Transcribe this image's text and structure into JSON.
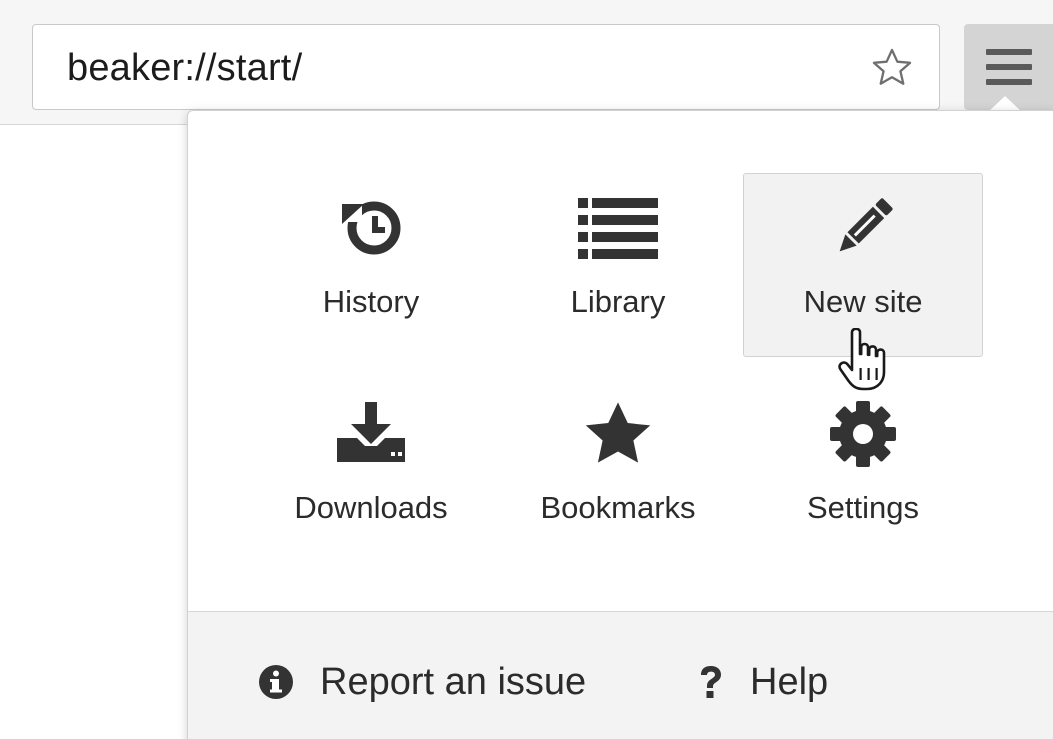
{
  "toolbar": {
    "url": "beaker://start/",
    "bookmark_icon": "star-outline-icon",
    "menu_icon": "hamburger-menu-icon"
  },
  "menu": {
    "items": [
      {
        "label": "History",
        "icon": "history-icon"
      },
      {
        "label": "Library",
        "icon": "list-icon"
      },
      {
        "label": "New site",
        "icon": "pencil-icon"
      },
      {
        "label": "Downloads",
        "icon": "download-icon"
      },
      {
        "label": "Bookmarks",
        "icon": "star-icon"
      },
      {
        "label": "Settings",
        "icon": "gear-icon"
      }
    ],
    "hovered_item": "New site",
    "footer": {
      "report_label": "Report an issue",
      "report_icon": "info-icon",
      "help_label": "Help",
      "help_icon": "question-icon"
    }
  },
  "colors": {
    "icon": "#333333",
    "text": "#2b2b2b",
    "toolbar_bg": "#f6f6f6",
    "footer_bg": "#f3f3f3",
    "hover_bg": "#f2f2f2"
  }
}
